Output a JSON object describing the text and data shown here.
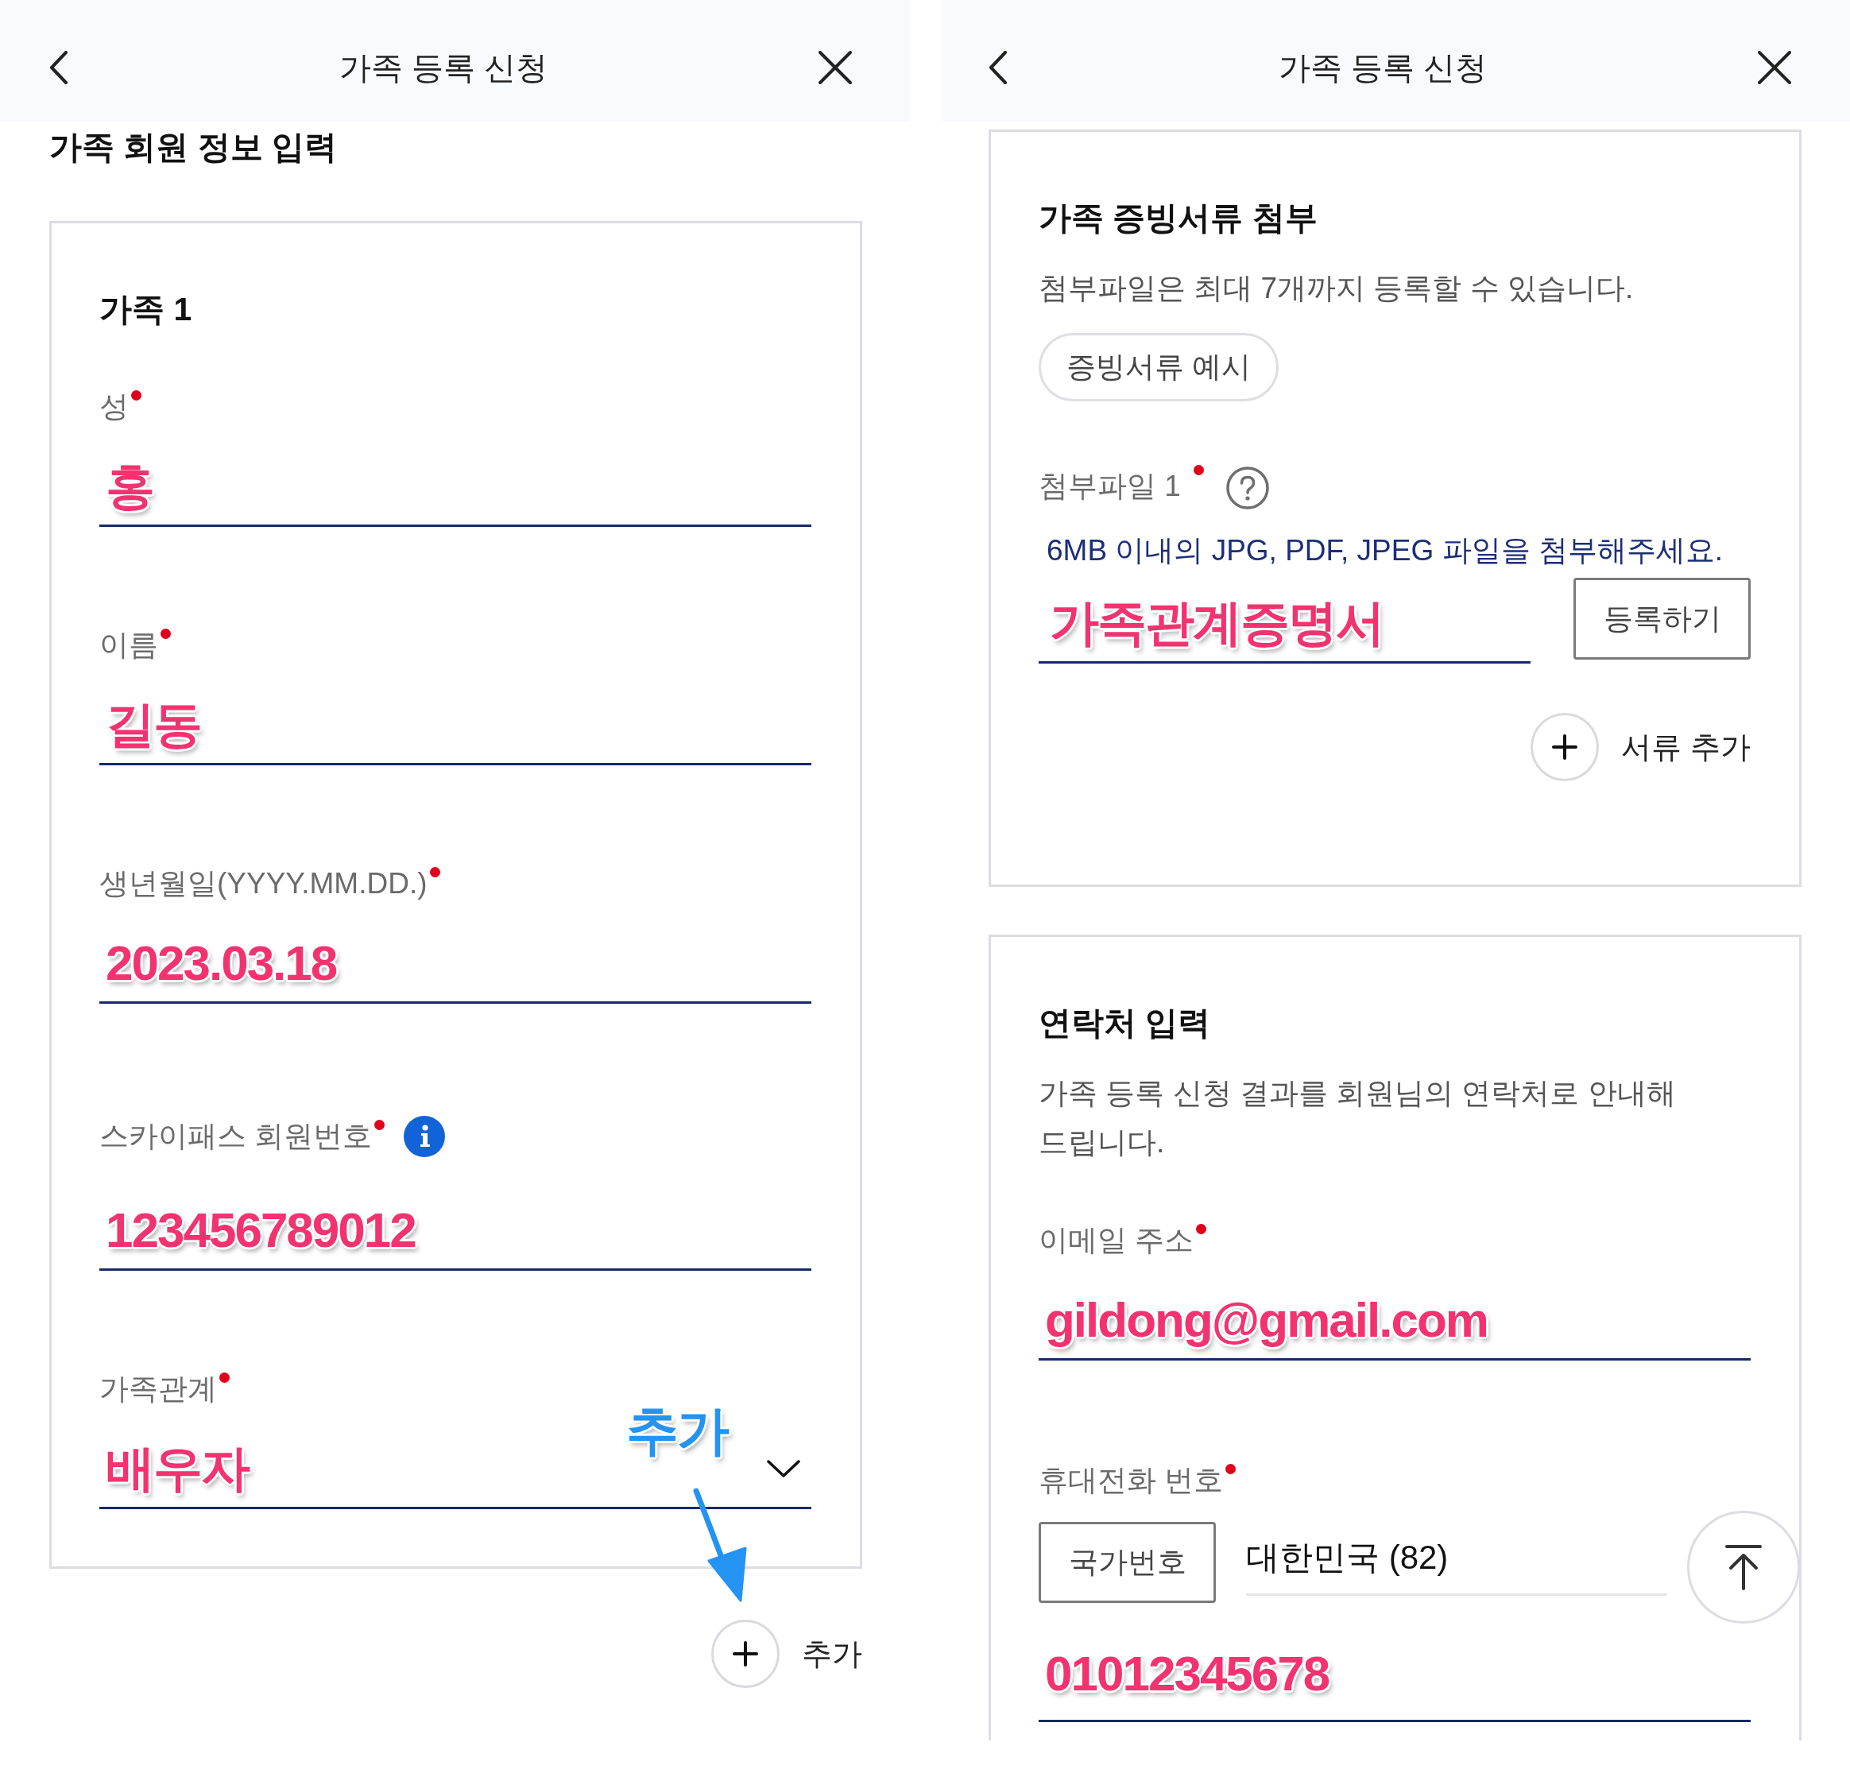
{
  "left_screen": {
    "header": {
      "title": "가족 등록 신청"
    },
    "section_title": "가족 회원 정보 입력",
    "family_card": {
      "title": "가족 1",
      "fields": [
        {
          "kind": "text",
          "label": "성",
          "required": true,
          "value": "홍"
        },
        {
          "kind": "text",
          "label": "이름",
          "required": true,
          "value": "길동"
        },
        {
          "kind": "text",
          "label": "생년월일(YYYY.MM.DD.)",
          "required": true,
          "value": "2023.03.18"
        },
        {
          "kind": "text",
          "label": "스카이패스 회원번호",
          "required": true,
          "info": true,
          "value": "123456789012"
        },
        {
          "kind": "select",
          "label": "가족관계",
          "required": true,
          "value": "배우자"
        }
      ]
    },
    "annotation": {
      "text": "추가"
    },
    "add_button": {
      "label": "추가"
    }
  },
  "right_screen": {
    "header": {
      "title": "가족 등록 신청"
    },
    "attachment_card": {
      "title": "가족 증빙서류 첨부",
      "description": "첨부파일은 최대 7개까지 등록할 수 있습니다.",
      "example_button": "증빙서류 예시",
      "files": [
        {
          "label": "첨부파일 1",
          "required": true,
          "help": true,
          "hint": "6MB 이내의 JPG, PDF, JPEG 파일을 첨부해주세요.",
          "value": "가족관계증명서",
          "button": "등록하기"
        }
      ],
      "add_button": {
        "label": "서류 추가"
      }
    },
    "contact_card": {
      "title": "연락처 입력",
      "description": "가족 등록 신청 결과를 회원님의 연락처로 안내해 드립니다.",
      "email": {
        "label": "이메일 주소",
        "required": true,
        "value": "gildong@gmail.com"
      },
      "phone": {
        "label": "휴대전화 번호",
        "required": true,
        "country_button": "국가번호",
        "country": "대한민국 (82)",
        "value": "01012345678"
      }
    }
  }
}
